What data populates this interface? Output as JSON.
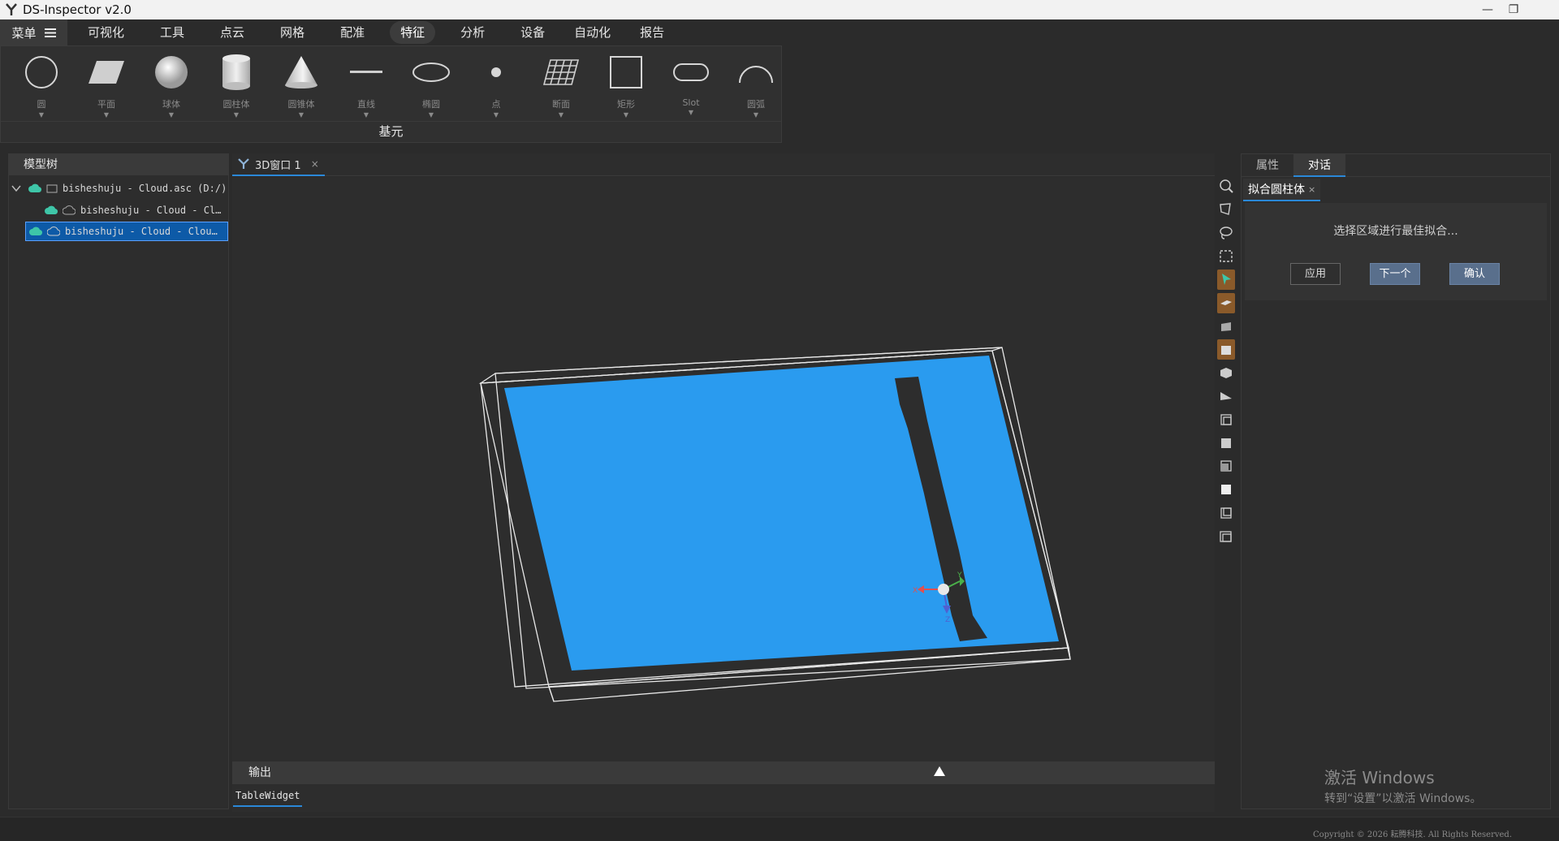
{
  "window": {
    "title": "DS-Inspector v2.0"
  },
  "menu": {
    "main_label": "菜单",
    "tabs": [
      "可视化",
      "工具",
      "点云",
      "网格",
      "配准",
      "特征",
      "分析",
      "设备",
      "自动化",
      "报告"
    ],
    "active_tab": "特征"
  },
  "ribbon": {
    "group_label": "基元",
    "tools": [
      {
        "label": "圆",
        "icon": "circle-icon"
      },
      {
        "label": "平面",
        "icon": "plane-icon"
      },
      {
        "label": "球体",
        "icon": "sphere-icon"
      },
      {
        "label": "圆柱体",
        "icon": "cylinder-icon"
      },
      {
        "label": "圆锥体",
        "icon": "cone-icon"
      },
      {
        "label": "直线",
        "icon": "line-icon"
      },
      {
        "label": "椭圆",
        "icon": "ellipse-icon"
      },
      {
        "label": "点",
        "icon": "point-icon"
      },
      {
        "label": "断面",
        "icon": "section-icon"
      },
      {
        "label": "矩形",
        "icon": "rectangle-icon"
      },
      {
        "label": "Slot",
        "icon": "slot-icon"
      },
      {
        "label": "圆弧",
        "icon": "arc-icon"
      }
    ]
  },
  "model_tree": {
    "title": "模型树",
    "items": [
      {
        "label": "bisheshuju - Cloud.asc (D:/)"
      },
      {
        "label": "bisheshuju - Cloud - Cl…"
      },
      {
        "label": "bisheshuju - Cloud - Clou…"
      }
    ]
  },
  "viewport": {
    "tab_label": "3D窗口 1",
    "axis_labels": {
      "x": "X",
      "y": "Y",
      "z": "Z"
    }
  },
  "output": {
    "title": "输出",
    "tab_label": "TableWidget"
  },
  "right_panel": {
    "tabs": [
      "属性",
      "对话"
    ],
    "active_tab": "对话",
    "dialog_tab_label": "拟合圆柱体",
    "message": "选择区域进行最佳拟合...",
    "buttons": {
      "apply": "应用",
      "next": "下一个",
      "confirm": "确认"
    }
  },
  "watermark": {
    "line1": "激活 Windows",
    "line2": "转到“设置”以激活 Windows。"
  },
  "status": {
    "copyright": "Copyright © 2026 耘腾科技. All Rights Reserved."
  },
  "colors": {
    "point_cloud": "#2a9bef",
    "accent": "#2a88d8",
    "cloud_icon": "#3ec6a8"
  }
}
